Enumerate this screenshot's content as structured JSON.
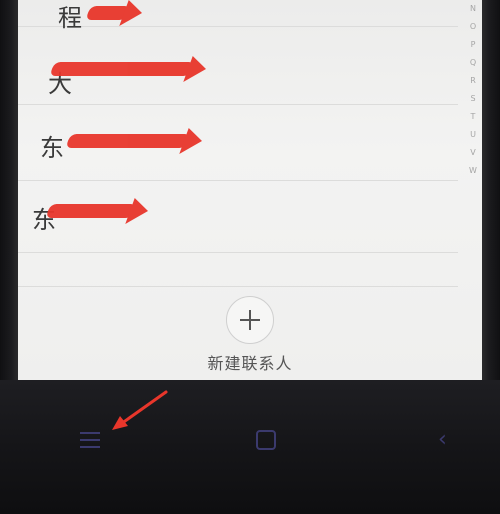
{
  "contacts": [
    {
      "name_visible": "程"
    },
    {
      "name_visible": "大"
    },
    {
      "name_visible": "东"
    },
    {
      "name_visible": "东"
    }
  ],
  "index_letters": [
    "N",
    "O",
    "P",
    "Q",
    "R",
    "S",
    "T",
    "U",
    "V",
    "W"
  ],
  "new_contact": {
    "label": "新建联系人",
    "icon": "plus-icon"
  },
  "navbar": {
    "menu_icon": "menu-icon",
    "home_icon": "home-icon",
    "back_icon": "back-icon",
    "back_glyph": "‹"
  },
  "colors": {
    "redaction": "#e8362b",
    "nav_icon": "#3b3a6e",
    "navbar_bg": "#151518"
  }
}
